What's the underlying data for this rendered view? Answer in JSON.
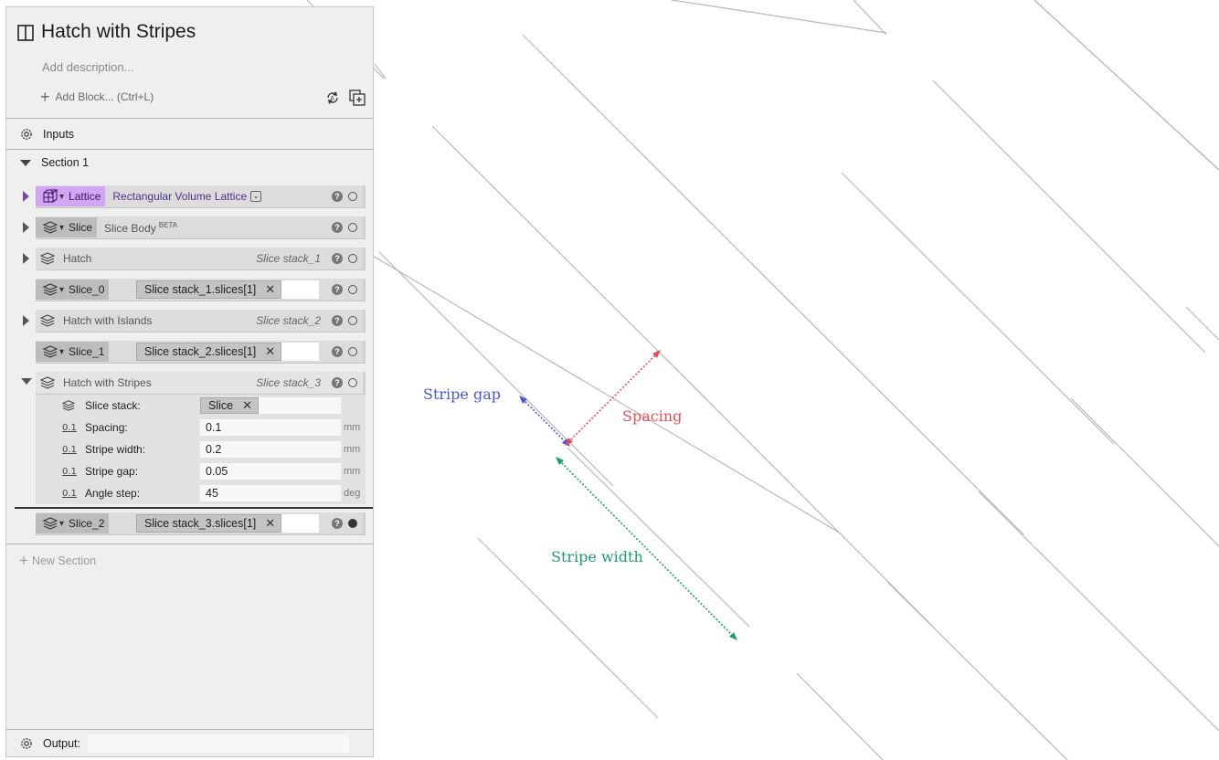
{
  "app": {
    "title": "Hatch with Stripes",
    "description_placeholder": "Add description...",
    "add_block_label": "Add Block... (Ctrl+L)"
  },
  "inputs": {
    "label": "Inputs"
  },
  "section": {
    "label": "Section 1"
  },
  "blocks": [
    {
      "kind": "Lattice",
      "name": "Rectangular Volume Lattice",
      "status": "open",
      "expanded": false
    },
    {
      "kind": "Slice",
      "name": "Slice Body",
      "badge": "BETA",
      "status": "open",
      "expanded": false
    },
    {
      "kind": "",
      "name": "Hatch",
      "sub": "Slice stack_1",
      "status": "open",
      "expanded": false
    },
    {
      "kind": "Slice_0",
      "chip": "Slice stack_1.slices[1]",
      "status": "open"
    },
    {
      "kind": "",
      "name": "Hatch with Islands",
      "sub": "Slice stack_2",
      "status": "open",
      "expanded": false
    },
    {
      "kind": "Slice_1",
      "chip": "Slice stack_2.slices[1]",
      "status": "open"
    },
    {
      "kind": "",
      "name": "Hatch with Stripes",
      "sub": "Slice stack_3",
      "status": "open",
      "expanded": true
    },
    {
      "kind": "Slice_2",
      "chip": "Slice stack_3.slices[1]",
      "status": "filled"
    }
  ],
  "params": {
    "slice_stack": {
      "label": "Slice stack:",
      "chip": "Slice"
    },
    "rows": [
      {
        "icon": "0.1",
        "label": "Spacing:",
        "value": "0.1",
        "unit": "mm"
      },
      {
        "icon": "0.1",
        "label": "Stripe width:",
        "value": "0.2",
        "unit": "mm"
      },
      {
        "icon": "0.1",
        "label": "Stripe gap:",
        "value": "0.05",
        "unit": "mm"
      },
      {
        "icon": "0.1",
        "label": "Angle step:",
        "value": "45",
        "unit": "deg"
      }
    ]
  },
  "new_section_label": "New Section",
  "output": {
    "label": "Output:",
    "value": ""
  },
  "annotations": {
    "stripe_gap": "Stripe gap",
    "spacing": "Spacing",
    "stripe_width": "Stripe width"
  },
  "colors": {
    "lattice_tag": "#d2a6f0",
    "gap_arrow": "#4a55d6",
    "spacing_arrow": "#e0505a",
    "width_arrow": "#1f9a72",
    "hatch_lines": "#b8b8b8"
  },
  "icons": {
    "title": "split-panel-icon",
    "inputs": "gear-icon",
    "block": "slice-stack-icon",
    "lattice": "lattice-cube-icon"
  }
}
